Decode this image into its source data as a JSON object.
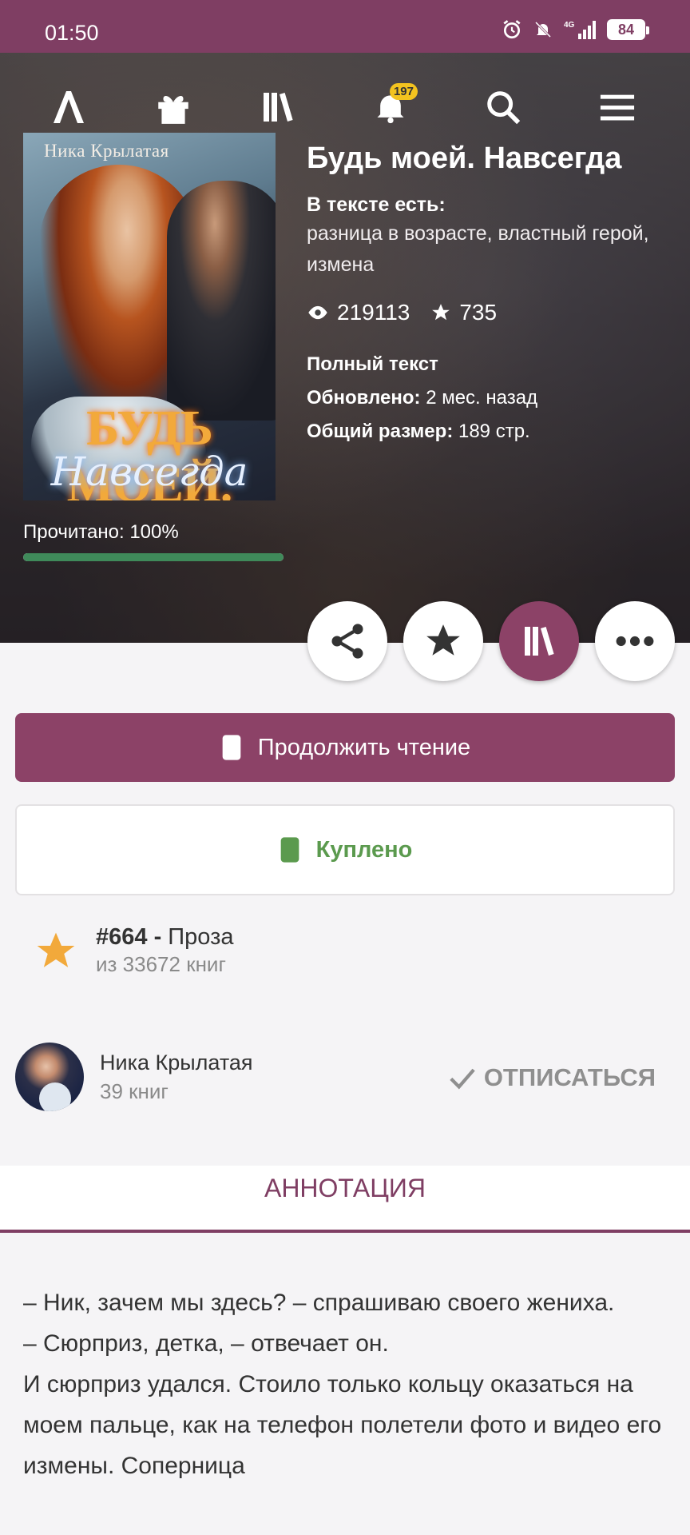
{
  "status_bar": {
    "time": "01:50",
    "battery": "84",
    "network": "4G"
  },
  "nav": {
    "notifications_count": "197"
  },
  "book": {
    "cover_author": "Ника Крылатая",
    "cover_title_line1": "БУДЬ МОЕЙ.",
    "cover_title_line2": "Навсегда",
    "title": "Будь моей. Навсегда",
    "tags_label": "В тексте есть:",
    "tags": "разница в возрасте, властный герой, измена",
    "views": "219113",
    "rating": "735",
    "status": "Полный текст",
    "updated_label": "Обновлено:",
    "updated_value": "2 мес. назад",
    "size_label": "Общий размер:",
    "size_value": "189 стр.",
    "read_label": "Прочитано: 100%",
    "read_progress": 1.0
  },
  "actions": {
    "continue_label": "Продолжить чтение",
    "bought_label": "Куплено"
  },
  "rank": {
    "position": "#664 -",
    "category": "Проза",
    "total": "из 33672 книг"
  },
  "author": {
    "name": "Ника Крылатая",
    "books": "39 книг",
    "unsubscribe_label": "ОТПИСАТЬСЯ"
  },
  "annotation": {
    "tab_label": "АННОТАЦИЯ",
    "lines": [
      "– Ник, зачем мы здесь? – спрашиваю своего жениха.",
      "– Сюрприз, детка, – отвечает он.",
      "И сюрприз удался. Стоило только кольцу оказаться на моем пальце, как на телефон полетели фото и видео его измены. Соперница"
    ]
  },
  "colors": {
    "brand": "#7f3e63",
    "accent_button": "#8c4267",
    "success": "#5b9a4e",
    "progress": "#3f8a5a",
    "badge": "#f3c31f"
  }
}
